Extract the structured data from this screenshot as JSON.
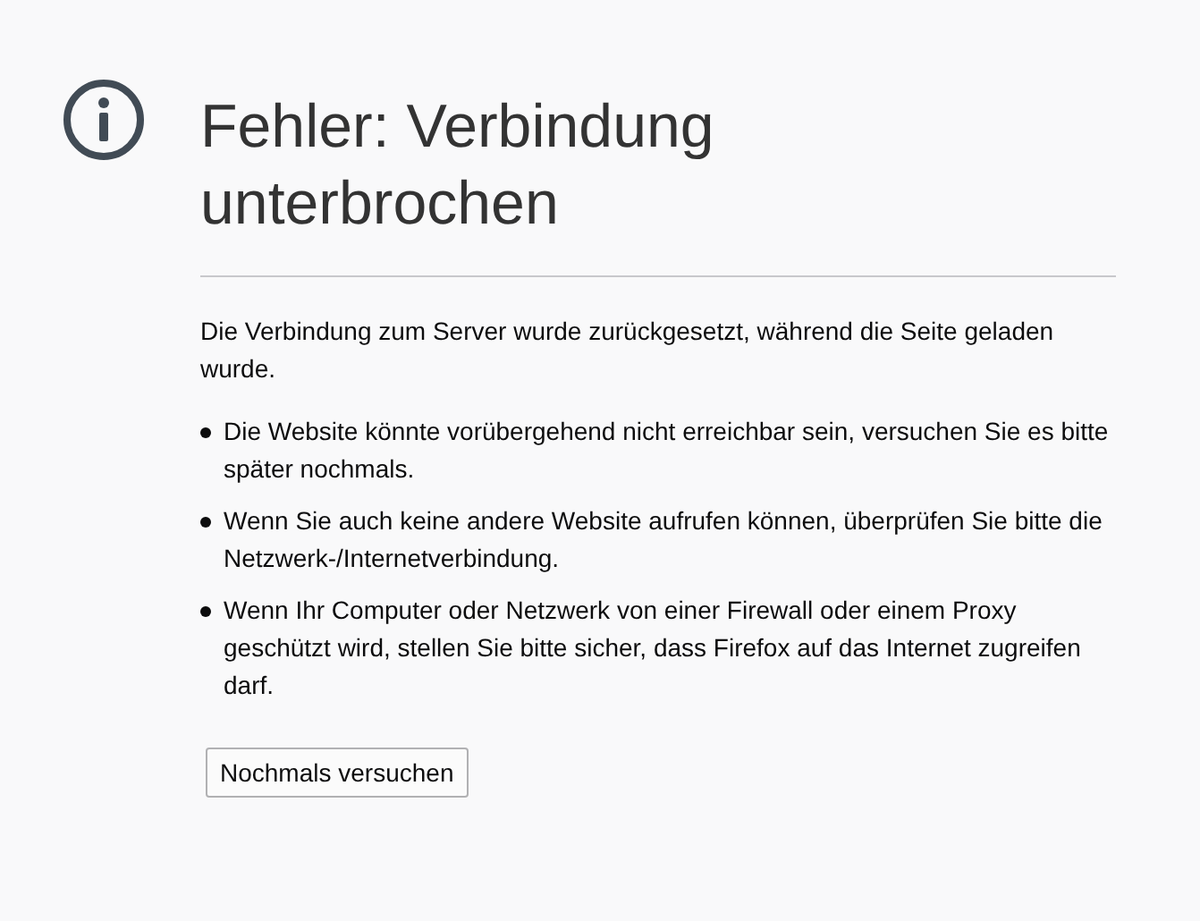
{
  "title": "Fehler: Verbindung unterbrochen",
  "description": "Die Verbindung zum Server wurde zurückgesetzt, während die Seite geladen wurde.",
  "bullets": [
    "Die Website könnte vorübergehend nicht erreichbar sein, versuchen Sie es bitte später nochmals.",
    "Wenn Sie auch keine andere Website aufrufen können, überprüfen Sie bitte die Netzwerk-/Internetverbindung.",
    "Wenn Ihr Computer oder Netzwerk von einer Firewall oder einem Proxy geschützt wird, stellen Sie bitte sicher, dass Firefox auf das Internet zugreifen darf."
  ],
  "button": "Nochmals versuchen"
}
